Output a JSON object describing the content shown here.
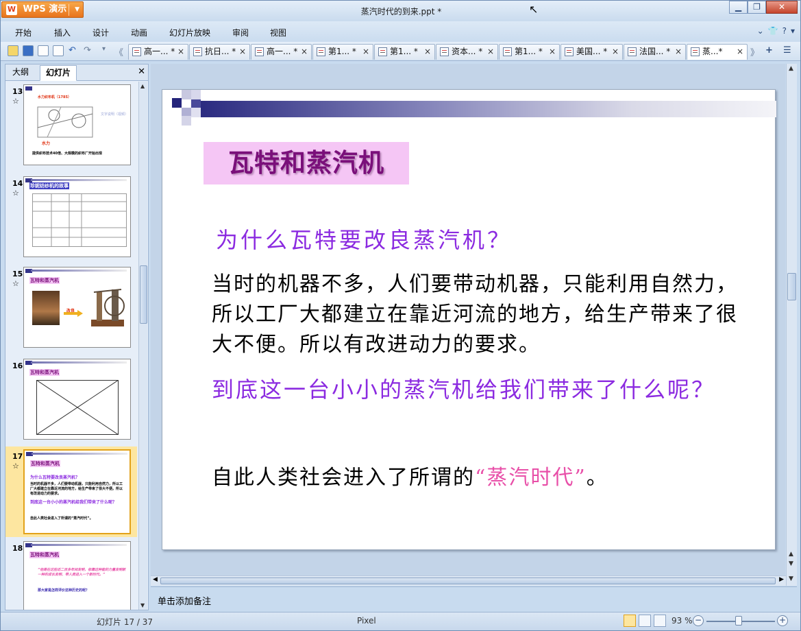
{
  "app": {
    "name": "WPS 演示",
    "logo_letter": "W"
  },
  "window": {
    "title": "蒸汽时代的到来.ppt *"
  },
  "menu": [
    "开始",
    "插入",
    "设计",
    "动画",
    "幻灯片放映",
    "审阅",
    "视图"
  ],
  "doc_tabs": [
    {
      "label": "高一... *"
    },
    {
      "label": "抗日... *"
    },
    {
      "label": "高一... *"
    },
    {
      "label": "第1... *"
    },
    {
      "label": "第1... *"
    },
    {
      "label": "资本... *"
    },
    {
      "label": "第1... *"
    },
    {
      "label": "美国... *"
    },
    {
      "label": "法国... *"
    },
    {
      "label": "蒸...*",
      "active": true
    }
  ],
  "left_pane": {
    "tabs": [
      "大纲",
      "幻灯片"
    ],
    "thumbnails": [
      {
        "number": "13",
        "star": "☆",
        "title": "水力织布机（1785）",
        "label2": "水力",
        "caption": "提供织布技术40倍、大规模的织布厂开始出现",
        "side": "文字说明（视频）"
      },
      {
        "number": "14",
        "star": "☆",
        "title": "珍妮纺纱机的故事"
      },
      {
        "number": "15",
        "star": "☆",
        "title": "瓦特和蒸汽机",
        "arrow_label": "改良"
      },
      {
        "number": "16",
        "star": "",
        "title": "瓦特和蒸汽机"
      },
      {
        "number": "17",
        "star": "☆",
        "title": "瓦特和蒸汽机",
        "selected": true,
        "q1": "为什么瓦特要改良蒸汽机？",
        "body": "当时的机器不多，人们要带动机器，只能利用自然力，所以工厂大都建立在靠近河流的地方，给生产带来了很大不便。所以有改进动力的要求。",
        "q2": "到底这一台小小的蒸汽机给我们带来了什么呢？",
        "concl": "自此人类社会进入了所谓的“蒸汽时代”。"
      },
      {
        "number": "18",
        "star": "",
        "title": "瓦特和蒸汽机",
        "quote": "“他是在这些近二百多年间发明，依靠这种能的力量发明新一种的成长发明、带人类进入一个新时代。”",
        "q": "那大家是怎样评价这种历史的呢？"
      }
    ]
  },
  "slide": {
    "title": "瓦特和蒸汽机",
    "question1": "为什么瓦特要改良蒸汽机？",
    "body": "当时的机器不多，人们要带动机器，只能利用自然力，所以工厂大都建立在靠近河流的地方，给生产带来了很大不便。所以有改进动力的要求。",
    "question2": "到底这一台小小的蒸汽机给我们带来了什么呢？",
    "conclusion_pre": "自此人类社会进入了所谓的",
    "conclusion_hl": "“蒸汽时代”",
    "conclusion_post": "。"
  },
  "notes": {
    "placeholder": "单击添加备注"
  },
  "status": {
    "slide_info": "幻灯片 17 / 37",
    "theme": "Pixel",
    "zoom": "93 %"
  },
  "colors": {
    "title_bg": "#f5c6f5",
    "title_fg": "#7a0f7a",
    "question": "#8b2ae0",
    "highlight": "#e84fa8"
  }
}
